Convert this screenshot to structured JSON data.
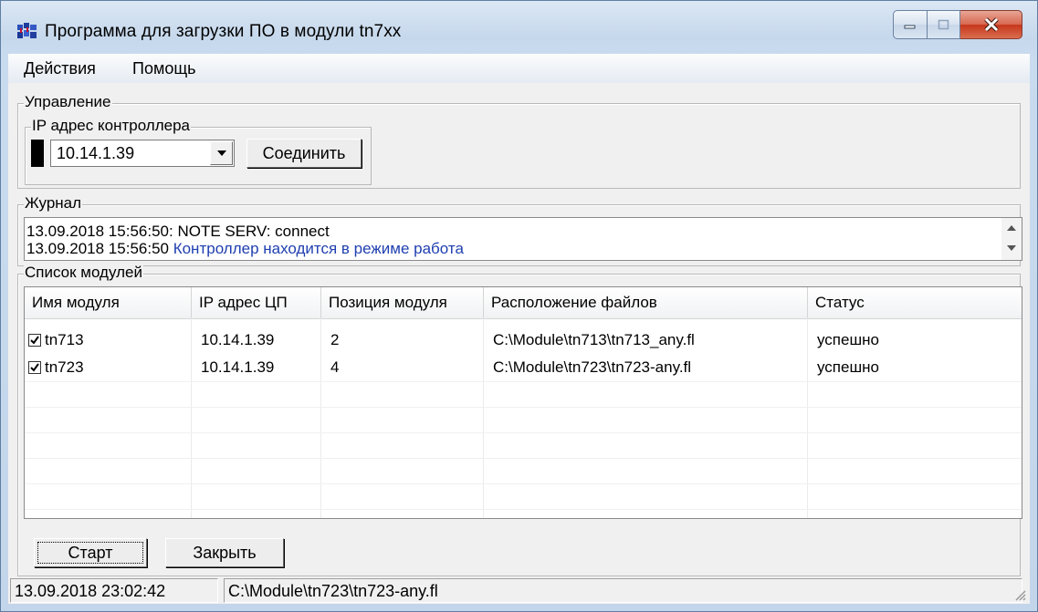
{
  "window": {
    "title": "Программа для загрузки ПО в модули tn7xx",
    "icon": "app-modules-icon"
  },
  "menu": [
    {
      "label": "Действия"
    },
    {
      "label": "Помощь"
    }
  ],
  "control_group": {
    "label": "Управление",
    "ip_group_label": "IP адрес контроллера",
    "ip_value": "10.14.1.39",
    "connect_label": "Соединить",
    "indicator_color": "#000000"
  },
  "journal": {
    "label": "Журнал",
    "lines": [
      {
        "prefix": "13.09.2018 15:56:50: ",
        "text": "NOTE SERV: connect",
        "color": "#000000"
      },
      {
        "prefix": "13.09.2018 15:56:50 ",
        "text": "Контроллер  находится в режиме работа",
        "color": "#1f3fb0"
      }
    ]
  },
  "modules": {
    "label": "Список модулей",
    "columns": [
      "Имя модуля",
      "IP адрес ЦП",
      "Позиция модуля",
      "Расположение файлов",
      "Статус"
    ],
    "rows": [
      {
        "checked": true,
        "name": "tn713",
        "ip": "10.14.1.39",
        "position": "2",
        "path": "C:\\Module\\tn713\\tn713_any.fl",
        "status": "успешно"
      },
      {
        "checked": true,
        "name": "tn723",
        "ip": "10.14.1.39",
        "position": "4",
        "path": "C:\\Module\\tn723\\tn723-any.fl",
        "status": "успешно"
      }
    ]
  },
  "buttons": {
    "start": "Старт",
    "close": "Закрыть"
  },
  "statusbar": {
    "datetime": "13.09.2018 23:02:42",
    "file": "C:\\Module\\tn723\\tn723-any.fl"
  }
}
